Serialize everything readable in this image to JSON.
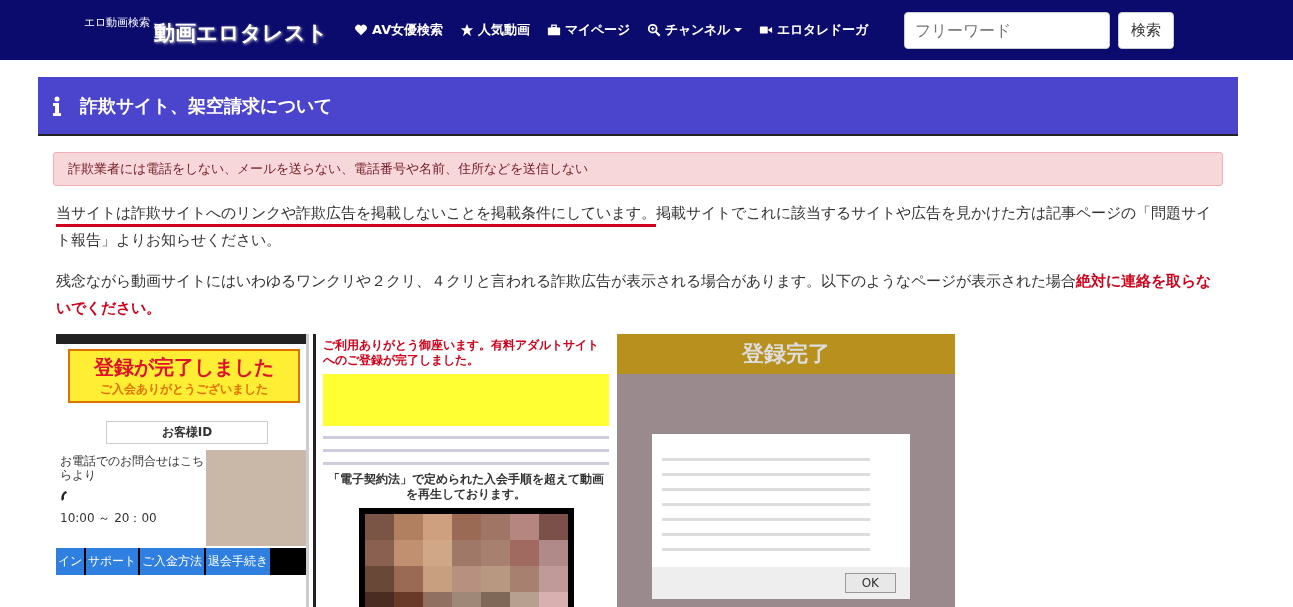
{
  "header": {
    "tagline": "エロ動画検索",
    "logo": "動画エロタレスト",
    "nav": [
      {
        "label": "AV女優検索",
        "dropdown": false
      },
      {
        "label": "人気動画",
        "dropdown": false
      },
      {
        "label": "マイページ",
        "dropdown": false
      },
      {
        "label": "チャンネル",
        "dropdown": true
      },
      {
        "label": "エロタレドーガ",
        "dropdown": false
      }
    ],
    "search": {
      "placeholder": "フリーワード",
      "button": "検索"
    }
  },
  "page_title": "詐欺サイト、架空請求について",
  "alert": "詐欺業者には電話をしない、メールを送らない、電話番号や名前、住所などを送信しない",
  "paragraphs": [
    [
      {
        "kind": "underlined",
        "text": "当サイトは詐欺サイトへのリンクや詐欺広告を掲載しないことを掲載条件にしています。"
      },
      {
        "kind": "plain",
        "text": "掲載サイトでこれに該当するサイトや広告を見かけた方は記事ページの「問題サイト報告」よりお知らせください。"
      }
    ],
    [
      {
        "kind": "plain",
        "text": "残念ながら動画サイトにはいわゆるワンクリや２クリ、４クリと言われる詐欺広告が表示される場合があります。以下のようなページが表示された場合"
      },
      {
        "kind": "warning",
        "text": "絶対に連絡を取らないでください。"
      }
    ]
  ],
  "figures": [
    {
      "kind": "registration",
      "banner_title": "登録が完了しました",
      "banner_subtitle": "ご入会ありがとうございました",
      "id_label": "お客様ID",
      "phone_note": "お電話でのお問合せはこちらより",
      "hours": "10:00 ～ 20：00",
      "tabs": [
        "イン",
        "サポート",
        "ご入金方法",
        "退会手続き"
      ]
    },
    {
      "kind": "invoice",
      "headline": "ご利用ありがとう御座います。有料アダルトサイトへのご登録が完了しました。",
      "caption": "「電子契約法」で定められた入会手順を超えて動画を再生しております。"
    },
    {
      "kind": "dialog",
      "banner": "登録完了",
      "button": "OK"
    }
  ]
}
